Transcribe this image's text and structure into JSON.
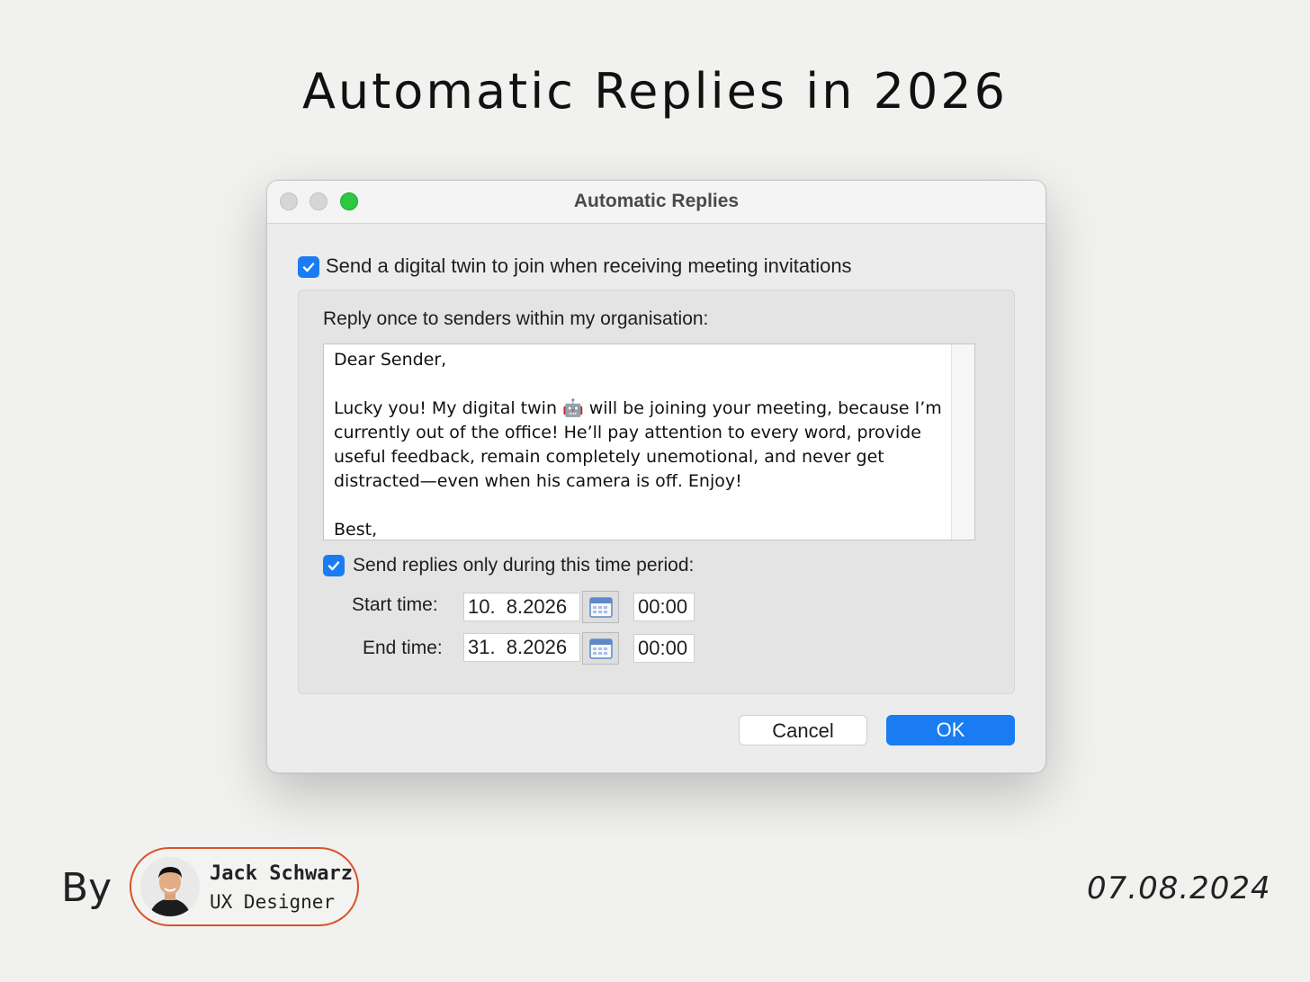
{
  "headline": "Automatic Replies in 2026",
  "window": {
    "title": "Automatic Replies",
    "digital_twin": {
      "checked": true,
      "label": "Send a digital twin to join when receiving meeting invitations"
    },
    "reply_section": {
      "label": "Reply once to senders within my organisation:",
      "message": "Dear Sender,\n\nLucky you! My digital twin 🤖 will be joining your meeting, because I’m currently out of the office! He’ll pay attention to every word, provide useful feedback, remain completely unemotional, and never get distracted—even when his camera is off. Enjoy!\n\nBest,",
      "time_period": {
        "checked": true,
        "label": "Send replies only during this time period:"
      },
      "start": {
        "label": "Start time:",
        "date": "10.  8.2026",
        "time": "00:00"
      },
      "end": {
        "label": "End time:",
        "date": "31.  8.2026",
        "time": "00:00"
      }
    },
    "buttons": {
      "cancel": "Cancel",
      "ok": "OK"
    }
  },
  "footer": {
    "by": "By",
    "author_name": "Jack Schwarz",
    "author_role": "UX Designer",
    "date": "07.08.2024"
  },
  "colors": {
    "accent": "#1a7cf3",
    "author_border": "#d6532a",
    "traffic_green": "#2cc840"
  }
}
